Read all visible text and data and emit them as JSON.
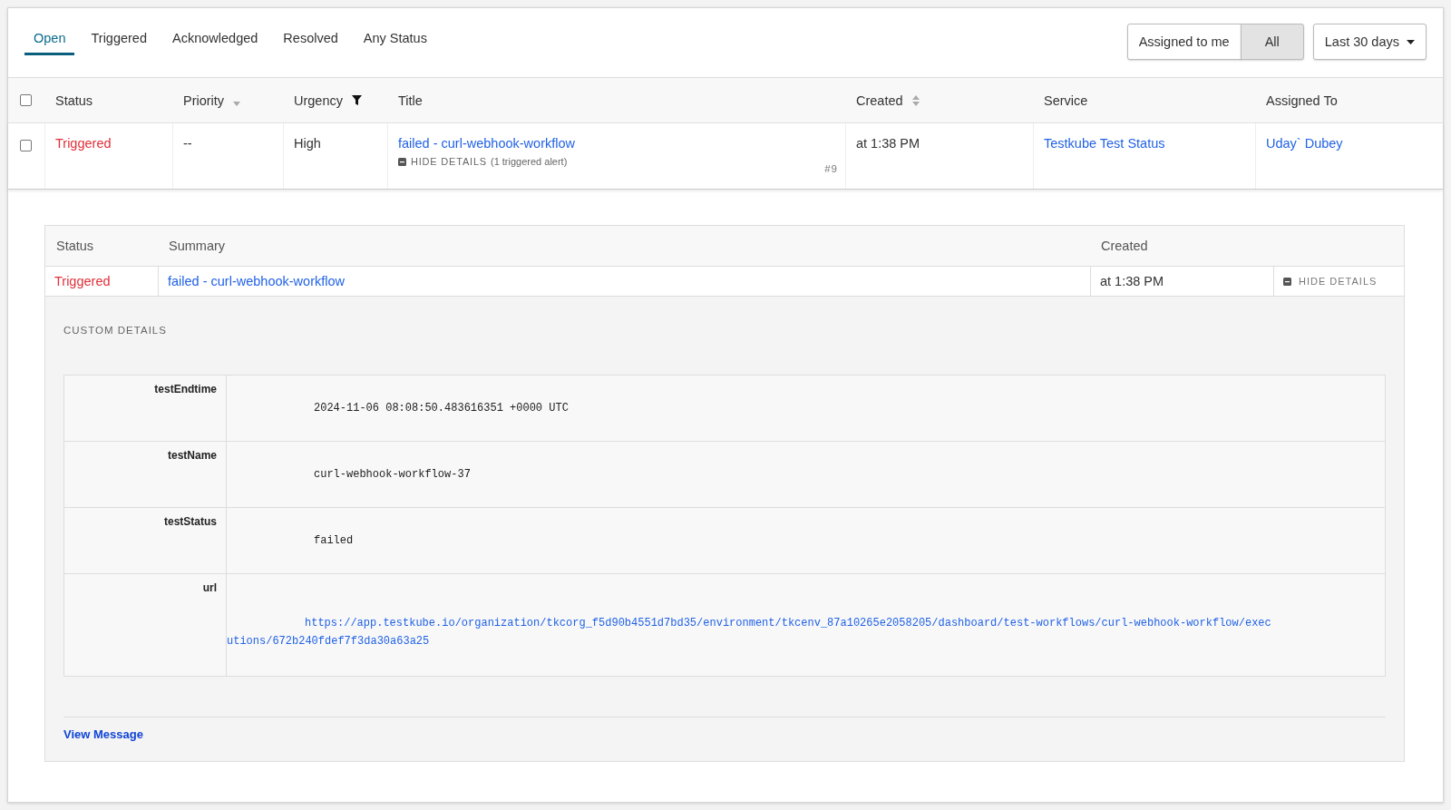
{
  "tabs": [
    {
      "label": "Open",
      "selected": true
    },
    {
      "label": "Triggered",
      "selected": false
    },
    {
      "label": "Acknowledged",
      "selected": false
    },
    {
      "label": "Resolved",
      "selected": false
    },
    {
      "label": "Any Status",
      "selected": false
    }
  ],
  "assignment_toggle": [
    {
      "label": "Assigned to me",
      "selected": false
    },
    {
      "label": "All",
      "selected": true
    }
  ],
  "date_range": {
    "label": "Last 30 days"
  },
  "incidents": {
    "all_checked": false,
    "columns": [
      {
        "label": "Status",
        "kind": "plain"
      },
      {
        "label": "Priority",
        "kind": "sort-desc"
      },
      {
        "label": "Urgency",
        "kind": "filter"
      },
      {
        "label": "Title",
        "kind": "plain"
      },
      {
        "label": "Created",
        "kind": "sort"
      },
      {
        "label": "Service",
        "kind": "plain"
      },
      {
        "label": "Assigned To",
        "kind": "plain"
      }
    ],
    "rows": [
      {
        "checked": false,
        "status": "Triggered",
        "priority": "--",
        "urgency": "High",
        "title": "failed - curl-webhook-workflow",
        "details_toggle": "HIDE DETAILS",
        "alert_count": "(1 triggered alert)",
        "number": "#9",
        "created": "at 1:38 PM",
        "service": "Testkube Test Status",
        "assigned_to": "Uday` Dubey",
        "expanded": true
      }
    ]
  },
  "alerts": {
    "columns": [
      "Status",
      "Summary",
      "Created"
    ],
    "rows": [
      {
        "status": "Triggered",
        "summary": "failed - curl-webhook-workflow",
        "created": "at 1:38 PM",
        "details_toggle": "HIDE DETAILS"
      }
    ],
    "custom_details_label": "CUSTOM DETAILS",
    "custom_details": [
      {
        "key": "testEndtime",
        "value": "2024-11-06 08:08:50.483616351 +0000 UTC",
        "kind": "text"
      },
      {
        "key": "testName",
        "value": "curl-webhook-workflow-37",
        "kind": "text"
      },
      {
        "key": "testStatus",
        "value": "failed",
        "kind": "text"
      },
      {
        "key": "url",
        "value": "https://app.testkube.io/organization/tkcorg_f5d90b4551d7bd35/environment/tkcenv_87a10265e2058205/dashboard/test-workflows/curl-webhook-workflow/executions/672b240fdef7f3da30a63a25",
        "kind": "link"
      }
    ],
    "view_message": "View Message"
  }
}
